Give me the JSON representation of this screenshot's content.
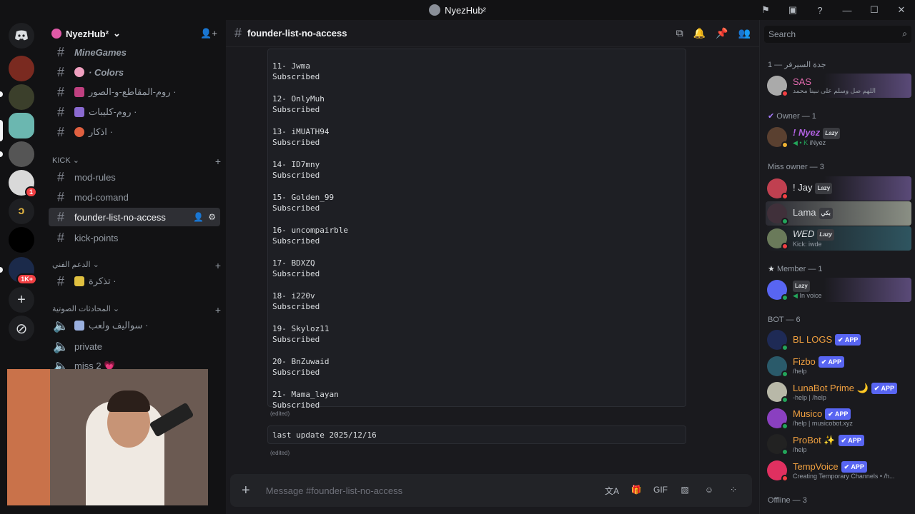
{
  "window": {
    "title": "NyezHub²"
  },
  "server": {
    "name": "NyezHub²"
  },
  "channels": {
    "items_top": [
      {
        "label": "MineGames"
      },
      {
        "label": "· Colors"
      },
      {
        "label": "روم-المقاطع-و-الصور ·"
      },
      {
        "label": "روم-كليبات ·"
      },
      {
        "label": "اذكار ·"
      }
    ],
    "category_kick": "KICK",
    "kick": [
      {
        "label": "mod-rules"
      },
      {
        "label": "mod-comand"
      },
      {
        "label": "founder-list-no-access"
      },
      {
        "label": "kick-points"
      }
    ],
    "category_support": "الدعم الفني",
    "support": [
      {
        "label": "تذكرة ·"
      }
    ],
    "category_voice": "المحادثات الصوتية",
    "voice": [
      {
        "label": "سواليف ولعب ·"
      },
      {
        "label": "private"
      },
      {
        "label": "miss 2 💗"
      }
    ]
  },
  "guild_badges": {
    "one": "1",
    "many": "1K+"
  },
  "chat": {
    "channel_name": "founder-list-no-access",
    "entries": [
      {
        "name": "11- Jwma",
        "status": "Subscribed"
      },
      {
        "name": "12- OnlyMuh",
        "status": "Subscribed"
      },
      {
        "name": "13- iMUATH94",
        "status": "Subscribed"
      },
      {
        "name": "14- ID7mny",
        "status": "Subscribed"
      },
      {
        "name": "15- Golden_99",
        "status": "Subscribed"
      },
      {
        "name": "16- uncompairble",
        "status": "Subscribed"
      },
      {
        "name": "17- BDXZQ",
        "status": "Subscribed"
      },
      {
        "name": "18- i220v",
        "status": "Subscribed"
      },
      {
        "name": "19- Skyloz11",
        "status": "Subscribed"
      },
      {
        "name": "20- BnZuwaid",
        "status": "Subscribed"
      },
      {
        "name": "21- Mama_layan",
        "status": "Subscribed"
      }
    ],
    "edited_label": "(edited)",
    "last_update": "last update 2025/12/16",
    "composer_placeholder": "Message #founder-list-no-access"
  },
  "members": {
    "search_placeholder": "Search",
    "group_top": "جدة السيرفر — 1",
    "sas": {
      "name": "SAS",
      "sub": "اللهم صل وسلم على نبينا محمد"
    },
    "group_owner": "Owner — 1",
    "nyez": {
      "name": "! Nyez",
      "tag": "Lazy",
      "sub": "iNyez"
    },
    "group_miss": "Miss owner — 3",
    "jay": {
      "name": "! Jay",
      "tag": "Lazy"
    },
    "lama": {
      "name": "Lama",
      "tag": "بكي"
    },
    "wed": {
      "name": "WED",
      "tag": "Lazy",
      "sub": "Kick: iwde"
    },
    "group_member": "Member — 1",
    "member1": {
      "tag": "Lazy",
      "sub": "In voice"
    },
    "group_bot": "BOT — 6",
    "bots": [
      {
        "name": "BL LOGS",
        "app": "APP",
        "sub": ""
      },
      {
        "name": "Fizbo",
        "app": "APP",
        "sub": "/help"
      },
      {
        "name": "LunaBot Prime 🌙",
        "app": "APP",
        "sub": "-help | /help"
      },
      {
        "name": "Musico",
        "app": "APP",
        "sub": "/help | musicobot.xyz"
      },
      {
        "name": "ProBot ✨",
        "app": "APP",
        "sub": "/help"
      },
      {
        "name": "TempVoice",
        "app": "APP",
        "sub": "Creating Temporary Channels • /h..."
      }
    ],
    "group_offline": "Offline — 3"
  }
}
